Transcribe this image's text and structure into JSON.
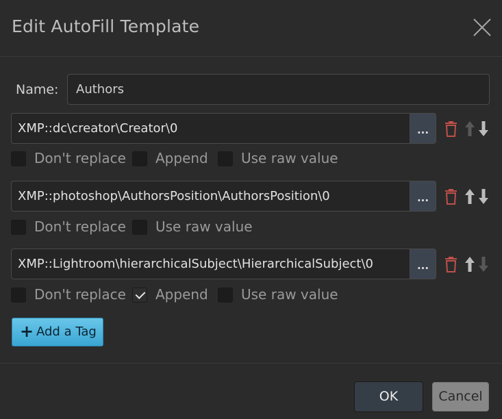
{
  "dialog": {
    "title": "Edit AutoFill Template",
    "close_icon": "close-icon"
  },
  "name": {
    "label": "Name:",
    "value": "Authors"
  },
  "tags": [
    {
      "value": "XMP::dc\\creator\\Creator\\0",
      "browse_label": "...",
      "options": [
        {
          "label": "Don't replace",
          "checked": false
        },
        {
          "label": "Append",
          "checked": false
        },
        {
          "label": "Use raw value",
          "checked": false
        }
      ],
      "up_enabled": false,
      "down_enabled": true
    },
    {
      "value": "XMP::photoshop\\AuthorsPosition\\AuthorsPosition\\0",
      "browse_label": "...",
      "options": [
        {
          "label": "Don't replace",
          "checked": false
        },
        {
          "label": "Use raw value",
          "checked": false
        }
      ],
      "up_enabled": true,
      "down_enabled": true
    },
    {
      "value": "XMP::Lightroom\\hierarchicalSubject\\HierarchicalSubject\\0",
      "browse_label": "...",
      "options": [
        {
          "label": "Don't replace",
          "checked": false
        },
        {
          "label": "Append",
          "checked": true
        },
        {
          "label": "Use raw value",
          "checked": false
        }
      ],
      "up_enabled": true,
      "down_enabled": false
    }
  ],
  "add_tag": {
    "icon": "plus-icon",
    "label": "Add a Tag"
  },
  "footer": {
    "ok_label": "OK",
    "cancel_label": "Cancel"
  },
  "colors": {
    "background": "#2b2b2b",
    "delete_icon": "#c0504a",
    "accent": "#4fb7e0"
  }
}
